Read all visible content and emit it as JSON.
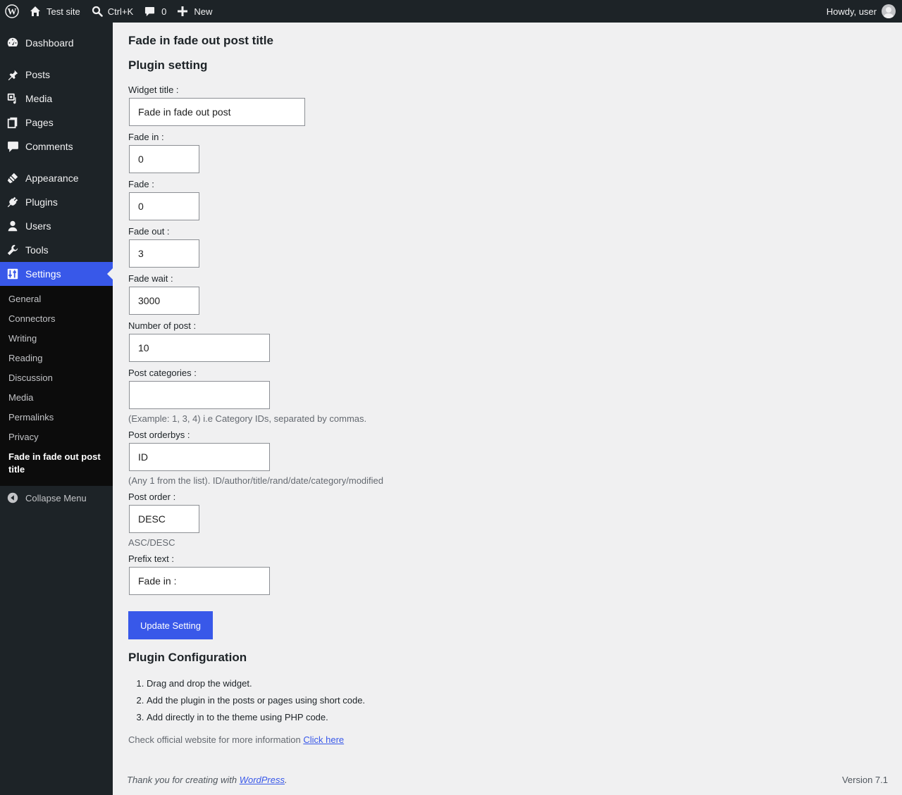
{
  "adminbar": {
    "site": "Test site",
    "search": "Ctrl+K",
    "comments_count": "0",
    "new": "New",
    "howdy": "Howdy, user"
  },
  "sidebar": {
    "items": [
      {
        "label": "Dashboard",
        "icon": "dashboard-icon"
      },
      {
        "label": "Posts",
        "icon": "pin-icon"
      },
      {
        "label": "Media",
        "icon": "media-icon"
      },
      {
        "label": "Pages",
        "icon": "pages-icon"
      },
      {
        "label": "Comments",
        "icon": "comment-icon"
      },
      {
        "label": "Appearance",
        "icon": "brush-icon"
      },
      {
        "label": "Plugins",
        "icon": "plugin-icon"
      },
      {
        "label": "Users",
        "icon": "user-icon"
      },
      {
        "label": "Tools",
        "icon": "wrench-icon"
      },
      {
        "label": "Settings",
        "icon": "settings-icon"
      }
    ],
    "submenu": [
      "General",
      "Connectors",
      "Writing",
      "Reading",
      "Discussion",
      "Media",
      "Permalinks",
      "Privacy",
      "Fade in fade out post title"
    ],
    "collapse": "Collapse Menu"
  },
  "main": {
    "page_title": "Fade in fade out post title",
    "section_title": "Plugin setting",
    "fields": {
      "widget_title": {
        "label": "Widget title :",
        "value": "Fade in fade out post"
      },
      "fade_in": {
        "label": "Fade in :",
        "value": "0"
      },
      "fade": {
        "label": "Fade :",
        "value": "0"
      },
      "fade_out": {
        "label": "Fade out :",
        "value": "3"
      },
      "fade_wait": {
        "label": "Fade wait :",
        "value": "3000"
      },
      "number_of_post": {
        "label": "Number of post :",
        "value": "10"
      },
      "post_categories": {
        "label": "Post categories :",
        "value": "",
        "hint": "(Example: 1, 3, 4) i.e Category IDs, separated by commas."
      },
      "post_orderbys": {
        "label": "Post orderbys :",
        "value": "ID",
        "hint": "(Any 1 from the list). ID/author/title/rand/date/category/modified"
      },
      "post_order": {
        "label": "Post order :",
        "value": "DESC",
        "hint": "ASC/DESC"
      },
      "prefix_text": {
        "label": "Prefix text :",
        "value": "Fade in :"
      }
    },
    "update_button": "Update Setting",
    "config_title": "Plugin Configuration",
    "config_steps": [
      "Drag and drop the widget.",
      "Add the plugin in the posts or pages using short code.",
      "Add directly in to the theme using PHP code."
    ],
    "info_text": "Check official website for more information",
    "info_link": "Click here"
  },
  "footer": {
    "thanks_prefix": "Thank you for creating with",
    "thanks_link": "WordPress",
    "thanks_suffix": ".",
    "version": "Version 7.1"
  },
  "colors": {
    "accent": "#3858e9",
    "sidebar_bg": "#1d2327",
    "page_bg": "#f0f0f1"
  }
}
